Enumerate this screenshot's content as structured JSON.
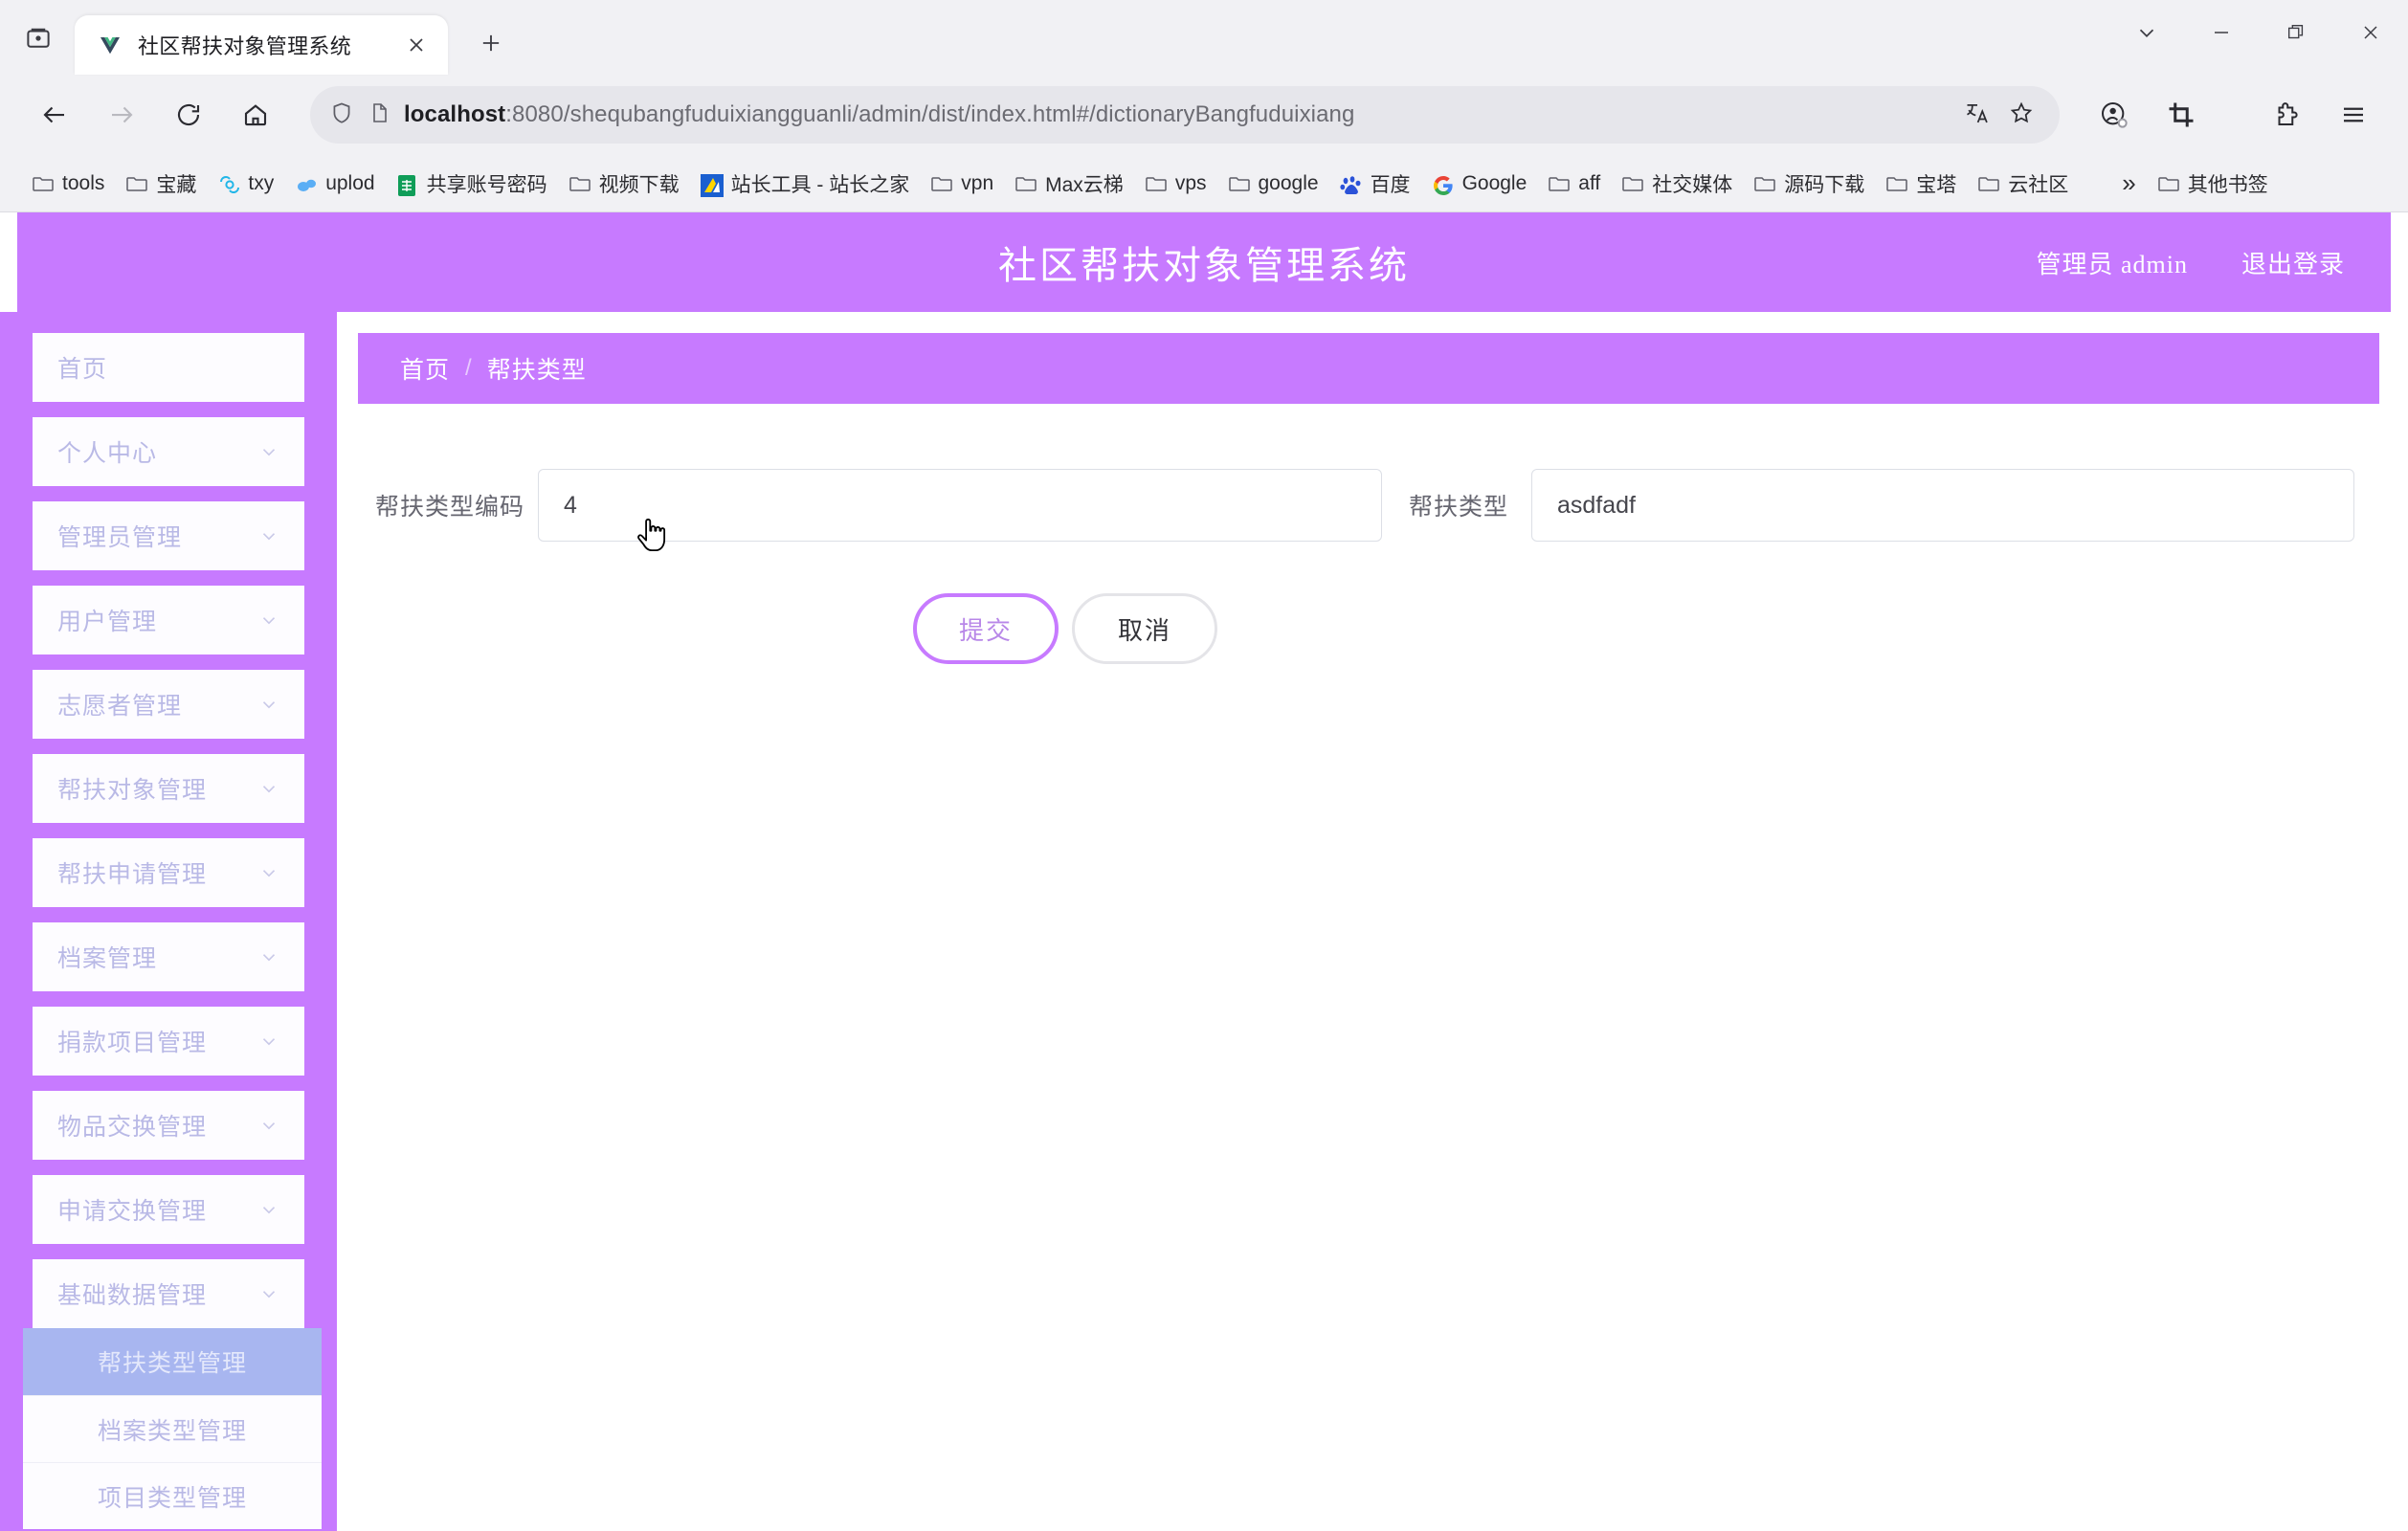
{
  "browser": {
    "tab": {
      "title": "社区帮扶对象管理系统",
      "favicon": "vue-logo-icon",
      "close": "×"
    },
    "new_tab_tooltip": "+",
    "window_controls": {
      "expand": "chevron-down-icon",
      "minimize": "—",
      "maximize": "▢",
      "close": "✕"
    },
    "nav": {
      "back": "back-arrow-icon",
      "forward": "forward-arrow-icon",
      "reload": "reload-icon",
      "home": "home-icon"
    },
    "omnibox": {
      "host": "localhost",
      "rest": ":8080/shequbangfuduixiangguanli/admin/dist/index.html#/dictionaryBangfuduixiang",
      "shield": "shield-icon",
      "page": "page-icon",
      "translate": "translate-icon",
      "bookmark": "star-icon"
    },
    "toolbar_right": {
      "profile": "profile-icon",
      "screenshot": "crop-icon",
      "extensions": "puzzle-icon",
      "menu": "hamburger-menu-icon"
    },
    "bookmarks": [
      {
        "label": "tools",
        "icon": "folder-icon"
      },
      {
        "label": "宝藏",
        "icon": "folder-icon"
      },
      {
        "label": "txy",
        "icon": "tencent-cloud-icon"
      },
      {
        "label": "uplod",
        "icon": "cloud-upload-icon"
      },
      {
        "label": "共享账号密码",
        "icon": "sheets-icon"
      },
      {
        "label": "视频下载",
        "icon": "folder-icon"
      },
      {
        "label": "站长工具 - 站长之家",
        "icon": "chinaz-icon"
      },
      {
        "label": "vpn",
        "icon": "folder-icon"
      },
      {
        "label": "Max云梯",
        "icon": "folder-icon"
      },
      {
        "label": "vps",
        "icon": "folder-icon"
      },
      {
        "label": "google",
        "icon": "folder-icon"
      },
      {
        "label": "百度",
        "icon": "baidu-icon"
      },
      {
        "label": "Google",
        "icon": "google-icon"
      },
      {
        "label": "aff",
        "icon": "folder-icon"
      },
      {
        "label": "社交媒体",
        "icon": "folder-icon"
      },
      {
        "label": "源码下载",
        "icon": "folder-icon"
      },
      {
        "label": "宝塔",
        "icon": "folder-icon"
      },
      {
        "label": "云社区",
        "icon": "folder-icon"
      }
    ],
    "bookmarks_overflow": "»",
    "other_bookmarks": {
      "label": "其他书签",
      "icon": "folder-icon"
    }
  },
  "app": {
    "title": "社区帮扶对象管理系统",
    "user_label": "管理员 admin",
    "logout_label": "退出登录",
    "accent_color": "#c77aff",
    "active_submenu_color": "#a8b6f0"
  },
  "sidebar": {
    "items": [
      {
        "label": "首页",
        "has_chevron": false
      },
      {
        "label": "个人中心",
        "has_chevron": true
      },
      {
        "label": "管理员管理",
        "has_chevron": true
      },
      {
        "label": "用户管理",
        "has_chevron": true
      },
      {
        "label": "志愿者管理",
        "has_chevron": true
      },
      {
        "label": "帮扶对象管理",
        "has_chevron": true
      },
      {
        "label": "帮扶申请管理",
        "has_chevron": true
      },
      {
        "label": "档案管理",
        "has_chevron": true
      },
      {
        "label": "捐款项目管理",
        "has_chevron": true
      },
      {
        "label": "物品交换管理",
        "has_chevron": true
      },
      {
        "label": "申请交换管理",
        "has_chevron": true
      },
      {
        "label": "基础数据管理",
        "has_chevron": true
      }
    ],
    "submenu": [
      {
        "label": "帮扶类型管理",
        "active": true
      },
      {
        "label": "档案类型管理",
        "active": false
      },
      {
        "label": "项目类型管理",
        "active": false
      }
    ]
  },
  "main": {
    "breadcrumb": {
      "home": "首页",
      "separator": "/",
      "current": "帮扶类型"
    },
    "form": {
      "fields": [
        {
          "label": "帮扶类型编码",
          "value": "4",
          "placeholder": "帮扶类型编码"
        },
        {
          "label": "帮扶类型",
          "value": "asdfadf",
          "placeholder": "帮扶类型"
        }
      ],
      "submit_label": "提交",
      "cancel_label": "取消"
    }
  }
}
